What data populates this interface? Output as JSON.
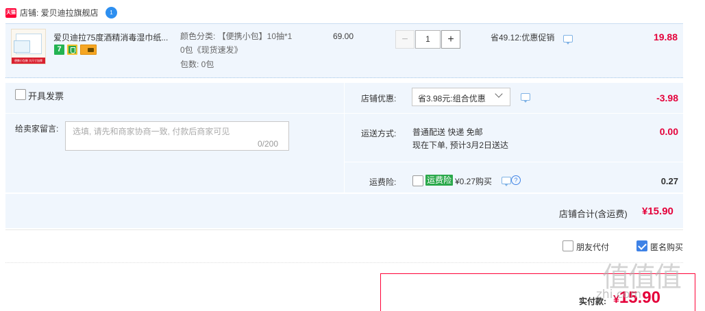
{
  "shop": {
    "badge": "天猫",
    "label": "店铺: 爱贝迪拉旗舰店",
    "chat_badge": "1"
  },
  "item": {
    "thumb_strip": "便携小包装 大尺寸加厚",
    "title": "爱贝迪拉75度酒精消毒湿巾纸...",
    "icon_7": "7",
    "sku_line1": "颜色分类: 【便携小包】10抽*1",
    "sku_line2": "0包《现货速发》",
    "sku_line3": "包数: 0包",
    "price": "69.00",
    "qty_minus": "−",
    "qty_value": "1",
    "qty_plus": "+",
    "promo": "省49.12:优惠促销",
    "subtotal": "19.88"
  },
  "invoice": {
    "label": "开具发票"
  },
  "memo": {
    "label": "给卖家留言:",
    "placeholder": "选填, 请先和商家协商一致, 付款后商家可见",
    "count": "0/200"
  },
  "shop_discount": {
    "label": "店铺优惠:",
    "selected": "省3.98元:组合优惠",
    "amount": "-3.98"
  },
  "shipping": {
    "label": "运送方式:",
    "line1": "普通配送 快递 免邮",
    "line2": "现在下单, 预计3月2日送达",
    "amount": "0.00"
  },
  "insurance": {
    "label": "运费险:",
    "tag": "运费险",
    "price": "¥0.27购买",
    "help": "?",
    "amount": "0.27"
  },
  "shop_total": {
    "label": "店铺合计(含运费)",
    "value": "¥15.90"
  },
  "options": {
    "friend_pay": "朋友代付",
    "anonymous": "匿名购买",
    "anonymous_checked": true
  },
  "payment": {
    "label": "实付款:",
    "currency": "¥",
    "amount": "15.90"
  },
  "watermark": {
    "main": "值值值",
    "sub": "zhi.com"
  },
  "colors": {
    "accent_red": "#e4003a",
    "tmall_red": "#ff0036",
    "panel_blue": "#f0f6fd",
    "check_blue": "#3e82e6"
  }
}
